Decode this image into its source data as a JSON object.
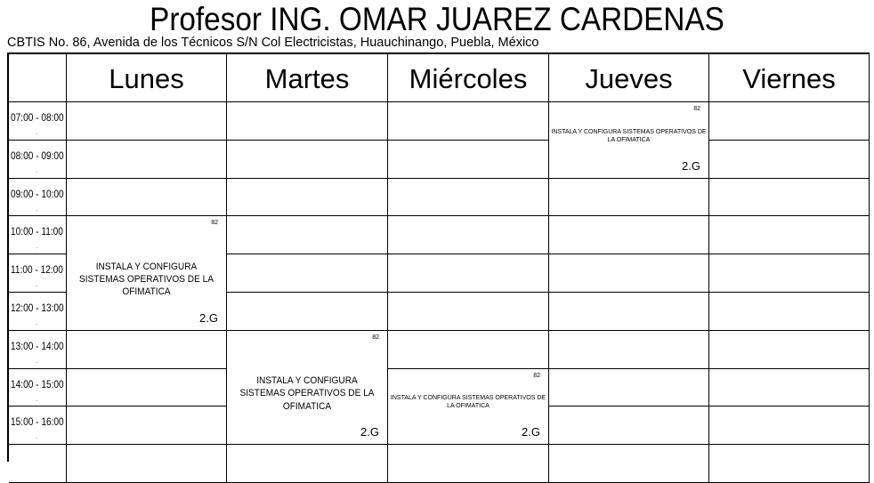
{
  "header": {
    "title": "Profesor ING. OMAR JUAREZ CARDENAS",
    "subtitle": "CBTIS No. 86, Avenida de los Técnicos S/N Col Electricistas, Huauchinango, Puebla, México"
  },
  "schedule": {
    "days": [
      "Lunes",
      "Martes",
      "Miércoles",
      "Jueves",
      "Viernes"
    ],
    "time_slots": [
      "07:00 - 08:00",
      "08:00 - 09:00",
      "09:00 - 10:00",
      "10:00 - 11:00",
      "11:00 - 12:00",
      "12:00 - 13:00",
      "13:00 - 14:00",
      "14:00 - 15:00",
      "15:00 - 16:00"
    ],
    "slot_marker": ".",
    "classes": [
      {
        "day": 0,
        "start": 3,
        "span": 3,
        "room": "82",
        "subject": "INSTALA Y CONFIGURA SISTEMAS OPERATIVOS DE LA OFIMATICA",
        "group": "2.G"
      },
      {
        "day": 1,
        "start": 6,
        "span": 3,
        "room": "82",
        "subject": "INSTALA Y CONFIGURA SISTEMAS OPERATIVOS DE LA OFIMATICA",
        "group": "2.G"
      },
      {
        "day": 2,
        "start": 7,
        "span": 2,
        "room": "82",
        "subject": "INSTALA Y CONFIGURA SISTEMAS OPERATIVOS DE LA OFIMATICA",
        "group": "2.G"
      },
      {
        "day": 3,
        "start": 0,
        "span": 2,
        "room": "82",
        "subject": "INSTALA Y CONFIGURA SISTEMAS OPERATIVOS DE LA OFIMATICA",
        "group": "2.G"
      }
    ]
  }
}
